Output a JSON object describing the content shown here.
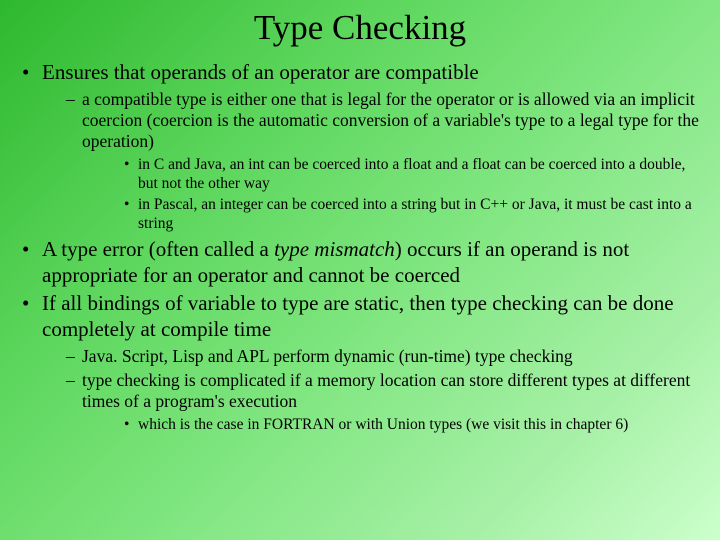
{
  "title": "Type Checking",
  "b1": "Ensures that operands of an operator are compatible",
  "b1_1": "a compatible type is either one that is legal for the operator or is allowed via an implicit coercion (coercion is the automatic conversion of a variable's type to a legal type for the operation)",
  "b1_1_1": "in C and Java, an int can be coerced into a float and a float can be coerced into a double, but not the other way",
  "b1_1_2": "in Pascal, an integer can be coerced into a string but in C++ or Java, it must be cast into a string",
  "b2_pre": "A type error (often called a ",
  "b2_em": "type mismatch",
  "b2_post": ") occurs if an operand is not appropriate for an operator and cannot be coerced",
  "b3": "If all bindings of variable to type are static, then type checking can be done completely at compile time",
  "b3_1": "Java. Script, Lisp and APL perform dynamic (run-time) type checking",
  "b3_2": "type checking is complicated if a memory location can store different types at different times of a program's execution",
  "b3_2_1": "which is the case in FORTRAN or with Union types (we visit this in chapter 6)"
}
